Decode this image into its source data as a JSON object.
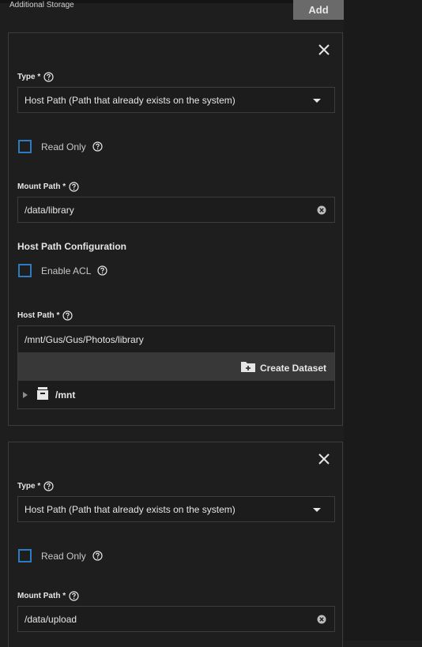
{
  "section": {
    "title": "Additional Storage",
    "add_label": "Add"
  },
  "cards": [
    {
      "type_label": "Type *",
      "type_value": "Host Path (Path that already exists on the system)",
      "read_only_label": "Read Only",
      "mount_path_label": "Mount Path *",
      "mount_path_value": "/data/library",
      "host_path_config_heading": "Host Path Configuration",
      "enable_acl_label": "Enable ACL",
      "host_path_label": "Host Path *",
      "host_path_value": "/mnt/Gus/Gus/Photos/library",
      "create_dataset_label": "Create Dataset",
      "tree_root": "/mnt"
    },
    {
      "type_label": "Type *",
      "type_value": "Host Path (Path that already exists on the system)",
      "read_only_label": "Read Only",
      "mount_path_label": "Mount Path *",
      "mount_path_value": "/data/upload"
    }
  ],
  "colors": {
    "checkbox_border": "#2f7bbf",
    "card_border": "#3c3c3c",
    "toolbar_bg": "#383838",
    "add_button_bg": "#6a6a6a"
  },
  "icons": [
    "close-icon",
    "help-icon",
    "chevron-down-icon",
    "clear-icon",
    "create-dataset-icon",
    "expand-icon",
    "dataset-icon"
  ]
}
